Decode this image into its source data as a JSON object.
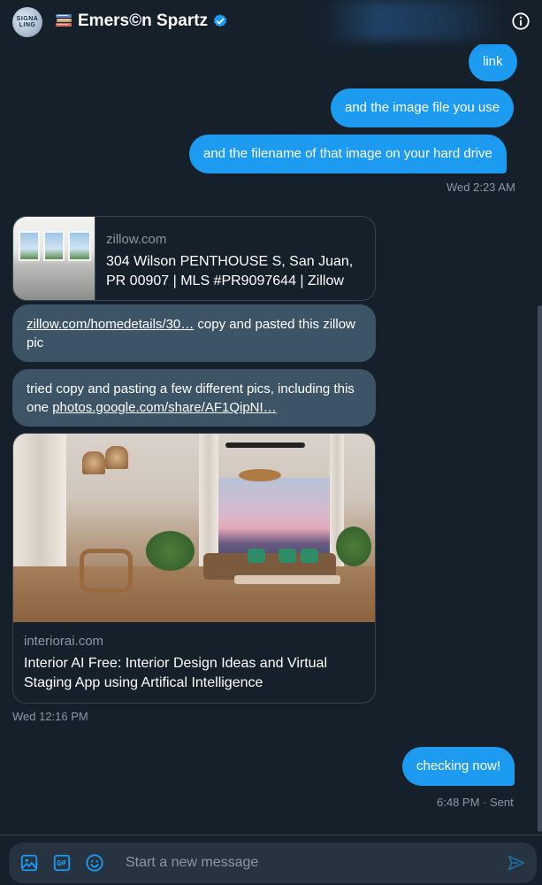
{
  "header": {
    "avatar_text": "SIGNALING",
    "name": "Emers©n Spartz",
    "colors": {
      "verified": "#1d9bf0",
      "background": "#15202b"
    }
  },
  "messages": {
    "out1": "link",
    "out2": "and the image file you use",
    "out3": "and the filename of that image on your hard drive",
    "out_time1": "Wed 2:23 AM",
    "card1": {
      "domain": "zillow.com",
      "title": "304 Wilson PENTHOUSE S, San Juan, PR 00907 | MLS #PR9097644 | Zillow"
    },
    "in1": {
      "link": "zillow.com/homedetails/30…",
      "text": " copy and pasted this zillow pic"
    },
    "in2": {
      "text": "tried copy and pasting a few different pics, including this one ",
      "link": "photos.google.com/share/AF1QipNI…"
    },
    "card2": {
      "domain": "interiorai.com",
      "title": "Interior AI Free: Interior Design Ideas and Virtual Staging App using Artifical Intelligence"
    },
    "in_time": "Wed 12:16 PM",
    "out4": "checking now!",
    "out_time2": "6:48 PM · Sent"
  },
  "composer": {
    "placeholder": "Start a new message",
    "icons": [
      "image-icon",
      "gif-icon",
      "emoji-icon",
      "send-icon"
    ]
  },
  "colors": {
    "outgoing_bubble": "#1d9bf0",
    "incoming_bubble": "#3d5466",
    "muted_text": "#8b98a5"
  }
}
